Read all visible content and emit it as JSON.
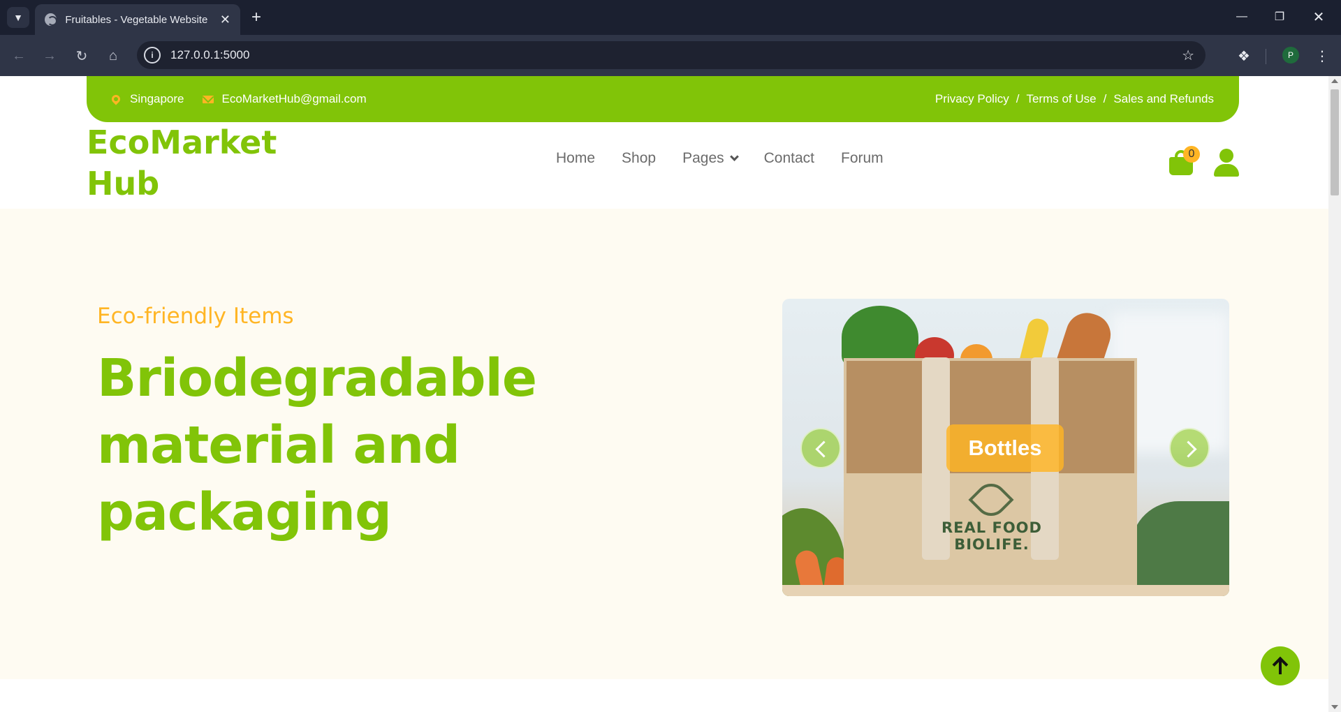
{
  "browser": {
    "tab_title": "Fruitables - Vegetable Website",
    "url": "127.0.0.1:5000",
    "profile_initial": "P",
    "icons": {
      "tab_menu": "chevron-down-icon",
      "new_tab": "plus-icon",
      "back": "arrow-left-icon",
      "forward": "arrow-right-icon",
      "reload": "reload-icon",
      "home": "home-icon",
      "bookmark": "star-icon",
      "extensions": "puzzle-icon",
      "menu": "kebab-menu-icon"
    }
  },
  "topbar": {
    "location": "Singapore",
    "email": "EcoMarketHub@gmail.com",
    "links": [
      "Privacy Policy",
      "Terms of Use",
      "Sales and Refunds"
    ],
    "separator": "/"
  },
  "header": {
    "logo_line1": "EcoMarket",
    "logo_line2": "Hub",
    "nav": [
      "Home",
      "Shop",
      "Pages",
      "Contact",
      "Forum"
    ],
    "cart_count": "0"
  },
  "hero": {
    "eyebrow": "Eco-friendly Items",
    "heading_lines": [
      "Briodegradable",
      "material and",
      "packaging"
    ],
    "carousel_label": "Bottles",
    "bag_print_line1": "REAL FOOD",
    "bag_print_line2": "BIOLIFE."
  },
  "colors": {
    "primary_green": "#81c408",
    "accent_orange": "#ffb524",
    "hero_background": "#fefbf2"
  }
}
